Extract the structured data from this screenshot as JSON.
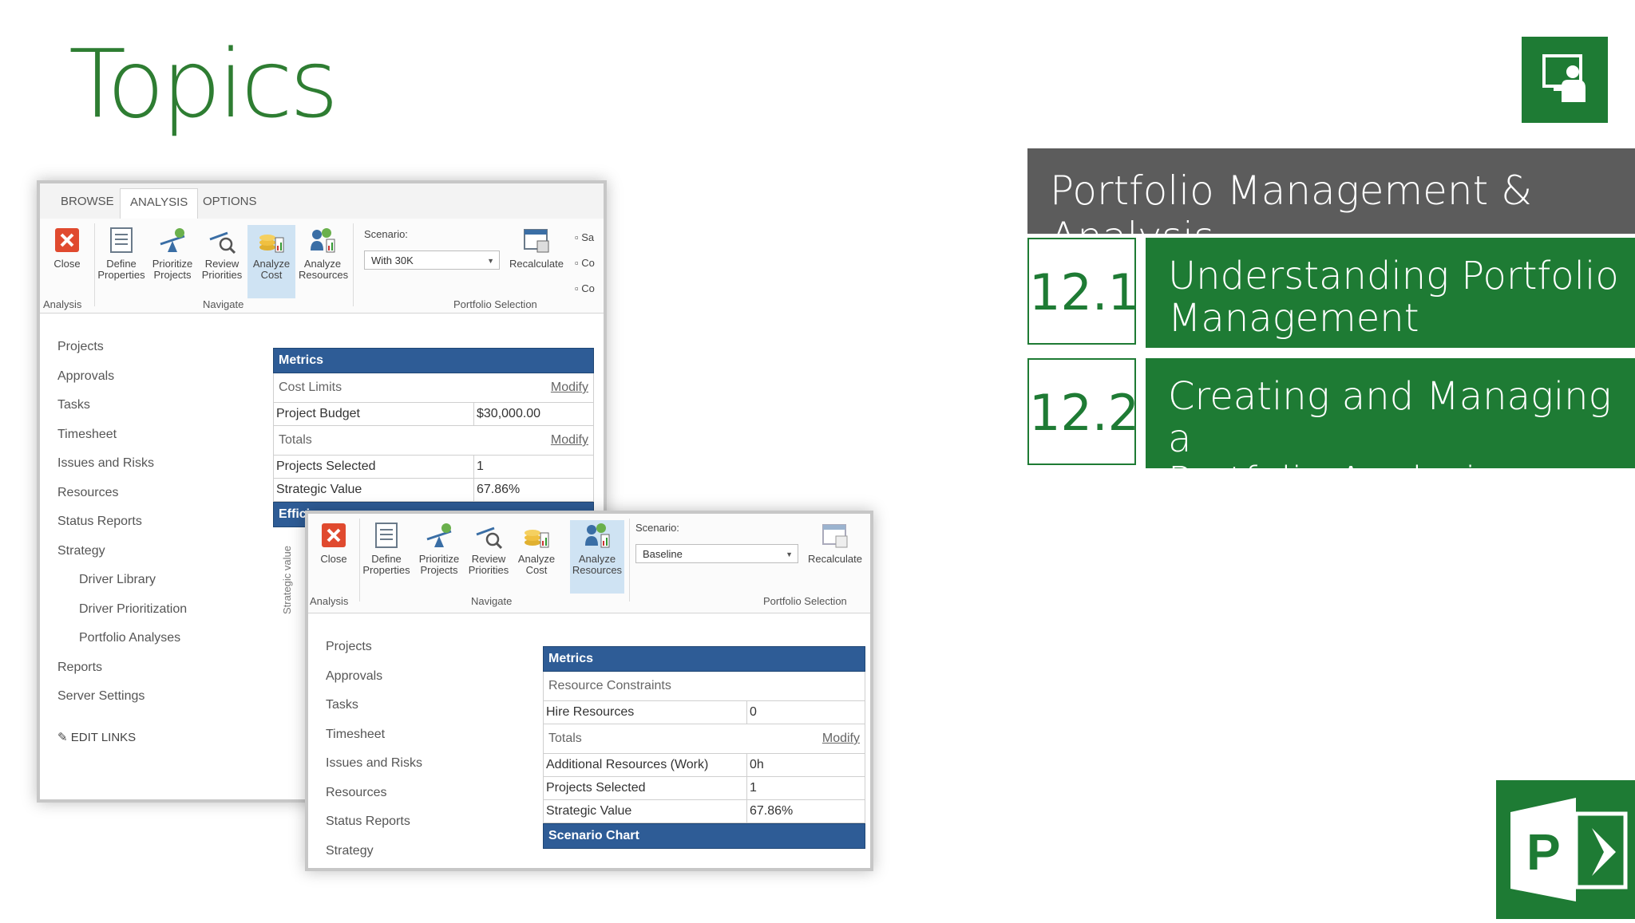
{
  "slide": {
    "title": "Topics",
    "banner": "Portfolio Management & Analysis",
    "topics": [
      {
        "num": "12.1",
        "label_line1": "Understanding Portfolio",
        "label_line2": "Management"
      },
      {
        "num": "12.2",
        "label_line1": "Creating and Managing a",
        "label_line2": "Portfolio Analysis"
      }
    ]
  },
  "back_window": {
    "tabs": [
      "BROWSE",
      "ANALYSIS",
      "OPTIONS"
    ],
    "ribbon": {
      "buttons": [
        {
          "l1": "Close",
          "l2": ""
        },
        {
          "l1": "Define",
          "l2": "Properties"
        },
        {
          "l1": "Prioritize",
          "l2": "Projects"
        },
        {
          "l1": "Review",
          "l2": "Priorities"
        },
        {
          "l1": "Analyze",
          "l2": "Cost"
        },
        {
          "l1": "Analyze",
          "l2": "Resources"
        }
      ],
      "groups": [
        "Analysis",
        "Navigate",
        "Portfolio Selection"
      ],
      "scenario_label": "Scenario:",
      "scenario_value": "With 30K",
      "recalculate": "Recalculate",
      "clipped": [
        "Sa",
        "Co",
        "Co"
      ]
    },
    "nav": [
      "Projects",
      "Approvals",
      "Tasks",
      "Timesheet",
      "Issues and Risks",
      "Resources",
      "Status Reports",
      "Strategy",
      "Driver Library",
      "Driver Prioritization",
      "Portfolio Analyses",
      "Reports",
      "Server Settings"
    ],
    "edit_links": "EDIT LINKS",
    "metrics": {
      "header": "Metrics",
      "cost_limits": "Cost Limits",
      "modify": "Modify",
      "project_budget_label": "Project Budget",
      "project_budget_value": "$30,000.00",
      "totals": "Totals",
      "projects_selected_label": "Projects Selected",
      "projects_selected_value": "1",
      "strategic_value_label": "Strategic Value",
      "strategic_value_value": "67.86%",
      "next_header": "Effici"
    },
    "axis_label": "Strategic value"
  },
  "front_window": {
    "ribbon": {
      "buttons": [
        {
          "l1": "Close",
          "l2": ""
        },
        {
          "l1": "Define",
          "l2": "Properties"
        },
        {
          "l1": "Prioritize",
          "l2": "Projects"
        },
        {
          "l1": "Review",
          "l2": "Priorities"
        },
        {
          "l1": "Analyze",
          "l2": "Cost"
        },
        {
          "l1": "Analyze",
          "l2": "Resources"
        }
      ],
      "groups": [
        "Analysis",
        "Navigate",
        "Portfolio Selection"
      ],
      "scenario_label": "Scenario:",
      "scenario_value": "Baseline",
      "recalculate": "Recalculate"
    },
    "nav": [
      "Projects",
      "Approvals",
      "Tasks",
      "Timesheet",
      "Issues and Risks",
      "Resources",
      "Status Reports",
      "Strategy"
    ],
    "metrics": {
      "header": "Metrics",
      "resource_constraints": "Resource Constraints",
      "hire_resources_label": "Hire Resources",
      "hire_resources_value": "0",
      "totals": "Totals",
      "modify": "Modify",
      "additional_resources_label": "Additional Resources (Work)",
      "additional_resources_value": "0h",
      "projects_selected_label": "Projects Selected",
      "projects_selected_value": "1",
      "strategic_value_label": "Strategic Value",
      "strategic_value_value": "67.86%",
      "chart_header": "Scenario Chart"
    }
  },
  "colors": {
    "green": "#1e7b34",
    "title_green": "#2e7d32",
    "banner_grey": "#5c5c5c",
    "metrics_blue": "#2e5c96"
  }
}
